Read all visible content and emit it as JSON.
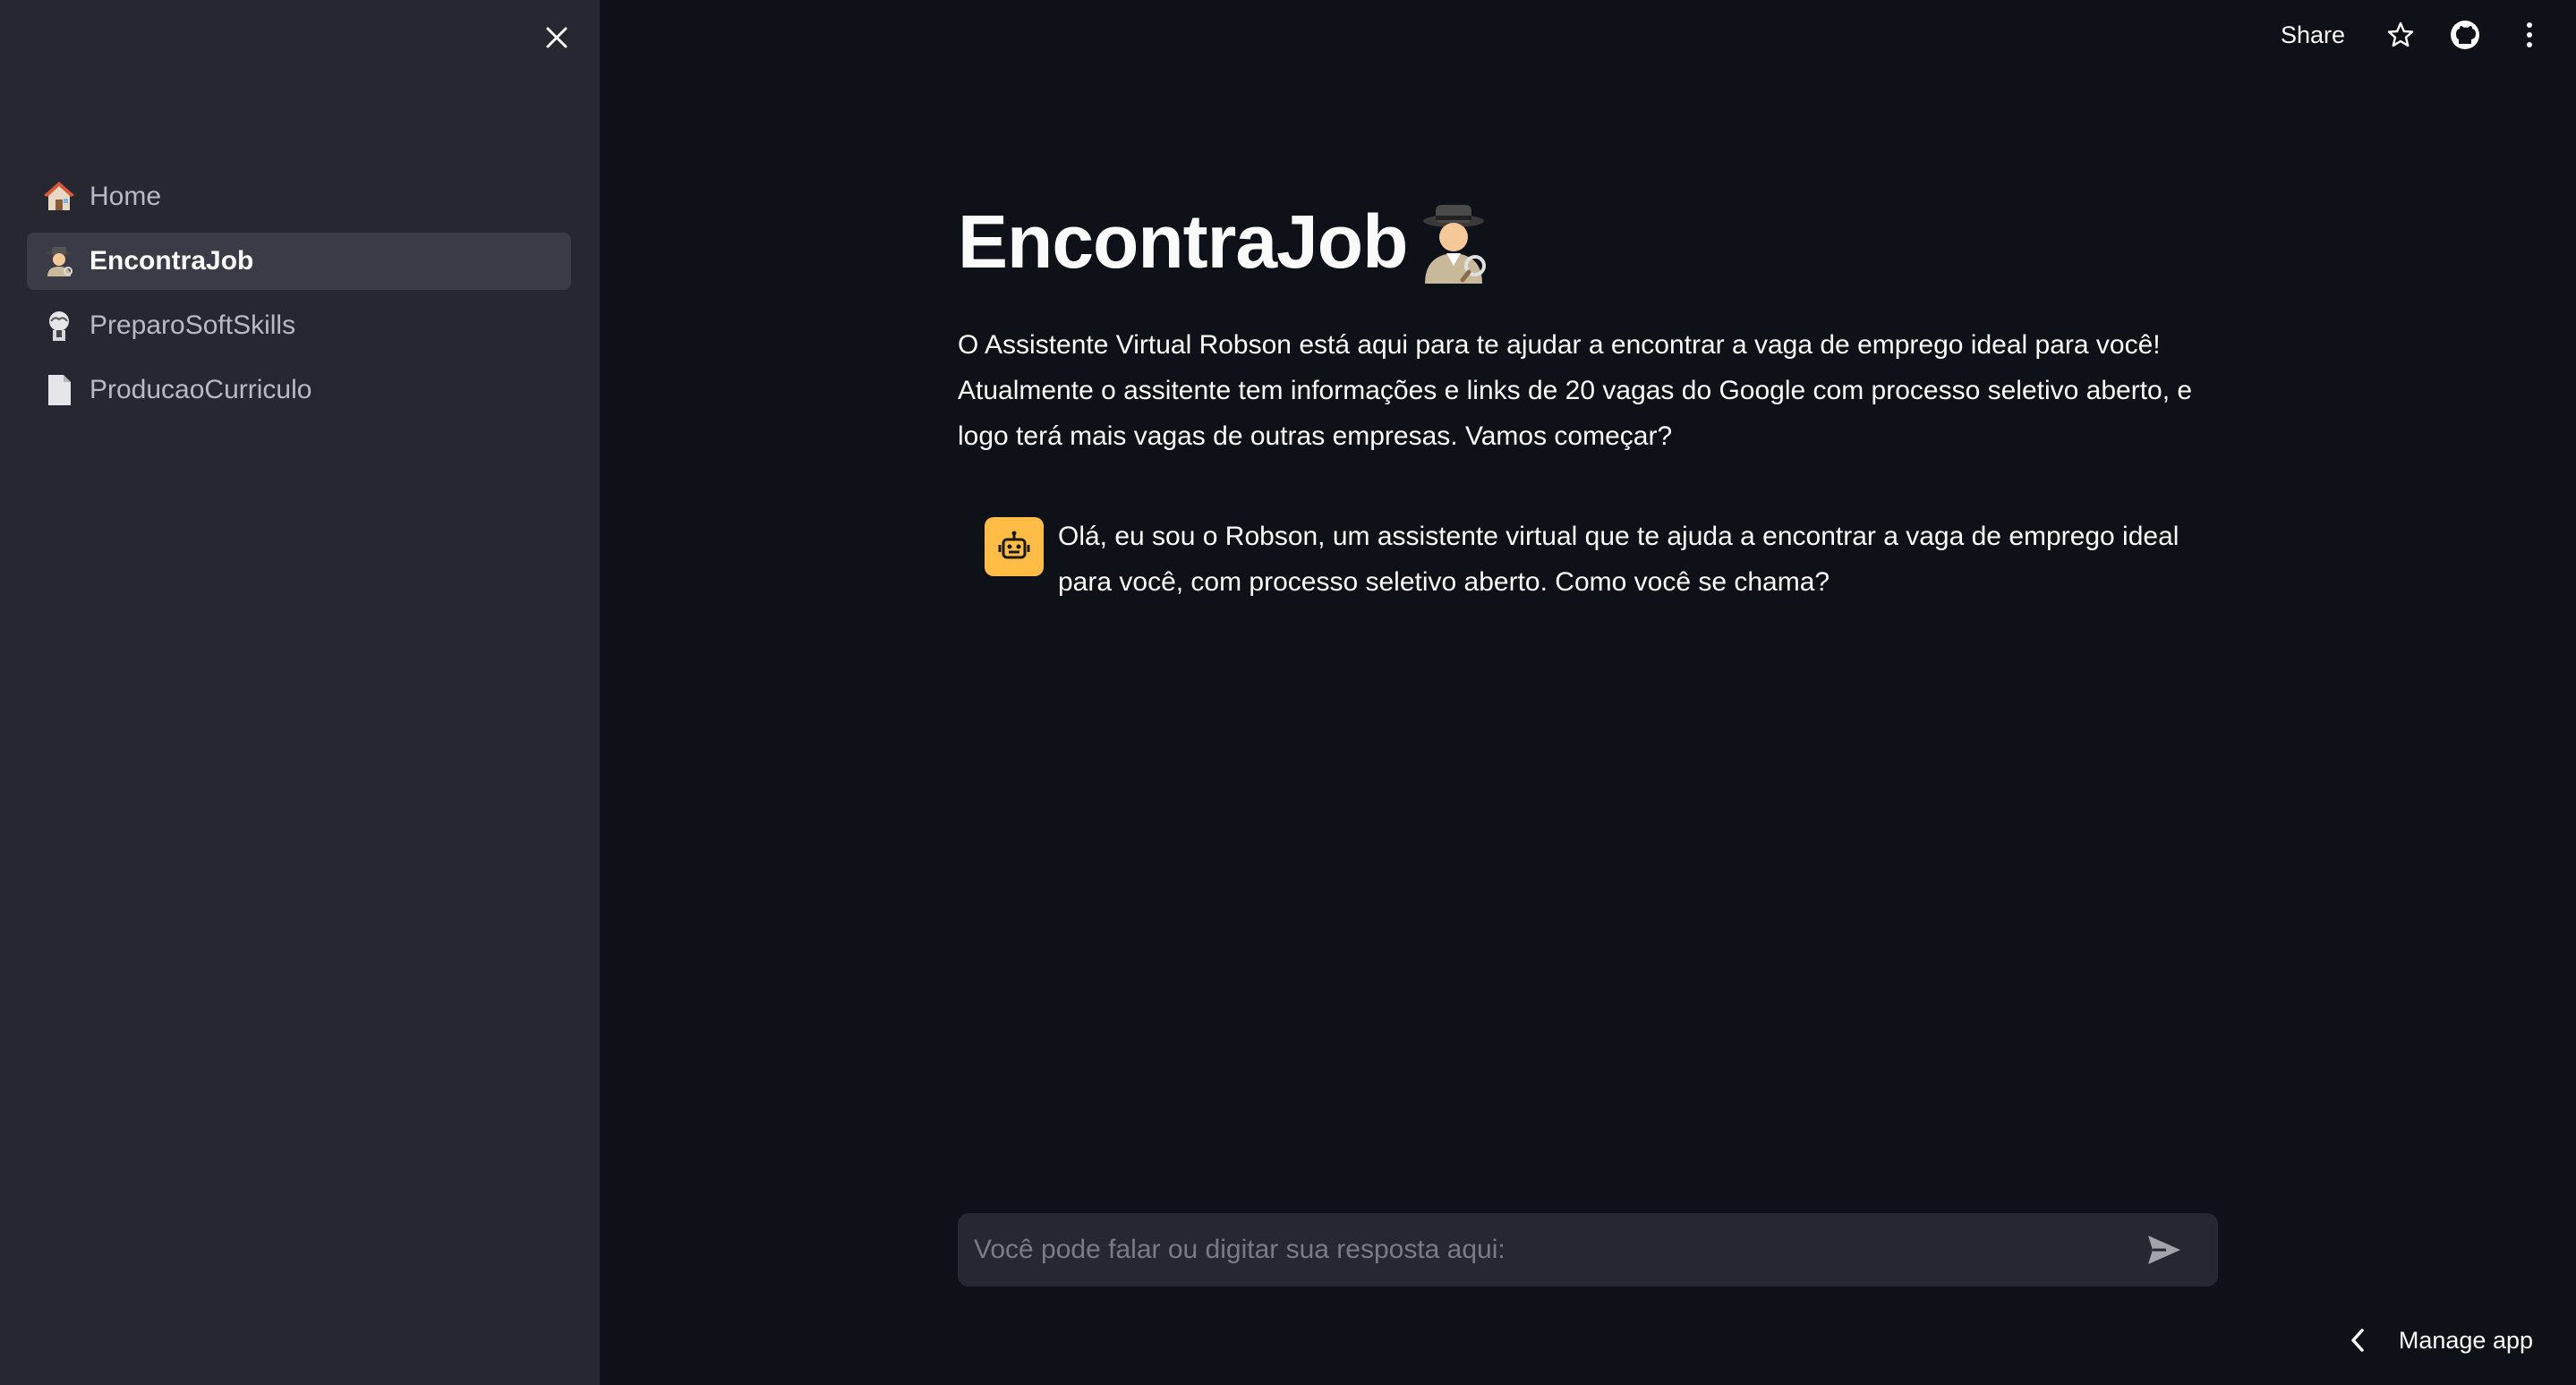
{
  "header": {
    "share_label": "Share",
    "icons": [
      "star-icon",
      "github-icon",
      "more-vert-icon"
    ]
  },
  "sidebar": {
    "close_icon": "close-icon",
    "items": [
      {
        "label": "Home",
        "icon": "house-icon",
        "active": false
      },
      {
        "label": "EncontraJob",
        "icon": "detective-icon",
        "active": true
      },
      {
        "label": "PreparoSoftSkills",
        "icon": "brain-icon",
        "active": false
      },
      {
        "label": "ProducaoCurriculo",
        "icon": "page-icon",
        "active": false
      }
    ]
  },
  "main": {
    "title": "EncontraJob",
    "title_icon": "detective-icon",
    "intro": "O Assistente Virtual Robson está aqui para te ajudar a encontrar a vaga de emprego ideal para você! Atualmente o assitente tem informações e links de 20 vagas do Google com processo seletivo aberto, e logo terá mais vagas de outras empresas. Vamos começar?",
    "messages": [
      {
        "role": "assistant",
        "avatar": "robot-icon",
        "text": "Olá, eu sou o Robson, um assistente virtual que te ajuda a encontrar a vaga de emprego ideal para você, com processo seletivo aberto. Como você se chama?"
      }
    ],
    "chat_input": {
      "placeholder": "Você pode falar ou digitar sua resposta aqui:",
      "value": ""
    }
  },
  "footer": {
    "manage_label": "Manage app"
  },
  "colors": {
    "sidebar_bg": "#262730",
    "main_bg": "#0e1117",
    "active_item_bg": "#3a3b46",
    "avatar_bg": "#ffbd45",
    "input_bg": "#262730"
  }
}
